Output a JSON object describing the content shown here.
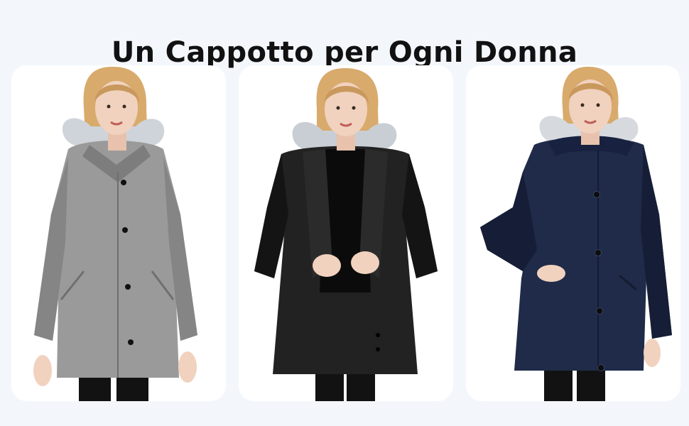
{
  "headline": "Un Cappotto per Ogni Donna",
  "products": [
    {
      "color_name": "grey",
      "coat_color": "#9a9a9a",
      "coat_shade": "#858585",
      "fur_color": "#cfd4da"
    },
    {
      "color_name": "black",
      "coat_color": "#222222",
      "coat_shade": "#141414",
      "fur_color": "#c9ced4"
    },
    {
      "color_name": "navy",
      "coat_color": "#1f2b48",
      "coat_shade": "#151e36",
      "fur_color": "#d6dade"
    }
  ],
  "colors": {
    "background": "#f3f7fc",
    "card": "#ffffff",
    "skin": "#f1d2bf",
    "hair": "#d8aa6c",
    "pants": "#121212",
    "buttons": "#111111"
  }
}
